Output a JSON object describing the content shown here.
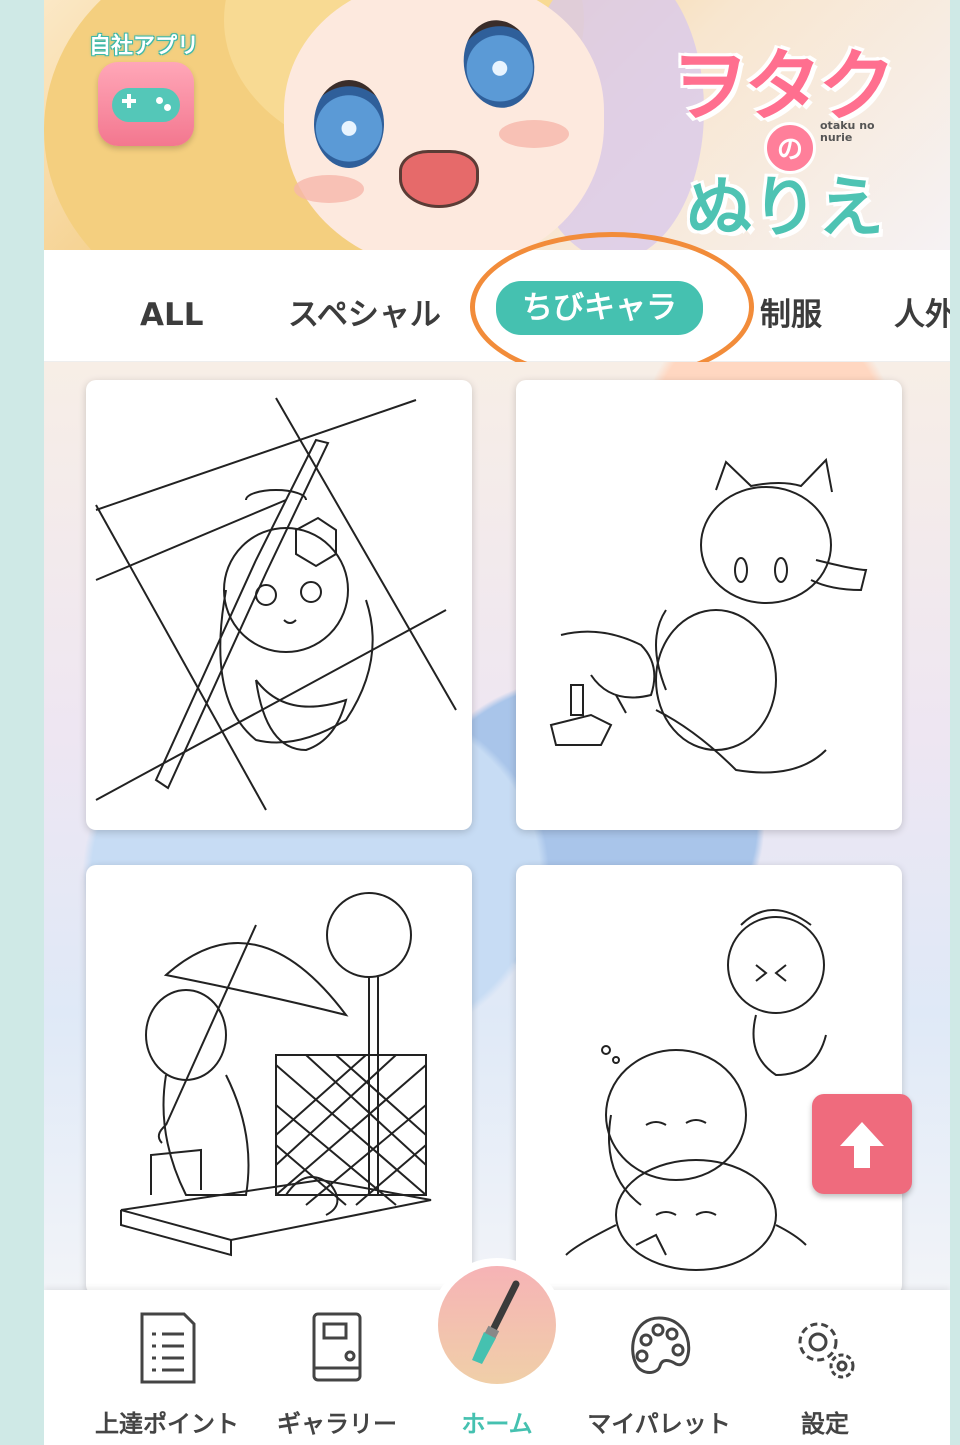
{
  "header": {
    "app_badge_label": "自社アプリ",
    "logo": {
      "line1": "ヲタク",
      "no": "の",
      "sub": "otaku no nurie",
      "line2": "ぬりえ"
    }
  },
  "tabs": [
    {
      "label": "ALL",
      "active": false
    },
    {
      "label": "スペシャル",
      "active": false
    },
    {
      "label": "ちびキャラ",
      "active": true
    },
    {
      "label": "制服",
      "active": false
    },
    {
      "label": "人外",
      "active": false
    }
  ],
  "cards": [
    {
      "name": "pen-tablet-girl-artwork"
    },
    {
      "name": "cat-ear-friends-artwork"
    },
    {
      "name": "umbrella-bus-stop-artwork"
    },
    {
      "name": "sleepy-girls-artwork"
    }
  ],
  "nav": [
    {
      "label": "上達ポイント",
      "icon": "document-list-icon",
      "active": false
    },
    {
      "label": "ギャラリー",
      "icon": "book-icon",
      "active": false
    },
    {
      "label": "ホーム",
      "icon": "paintbrush-icon",
      "active": true
    },
    {
      "label": "マイパレット",
      "icon": "palette-icon",
      "active": false
    },
    {
      "label": "設定",
      "icon": "gear-icon",
      "active": false
    }
  ],
  "colors": {
    "accent": "#45c1b0",
    "highlight_ring": "#f28c3a",
    "scroll_button": "#ef6b7d"
  }
}
